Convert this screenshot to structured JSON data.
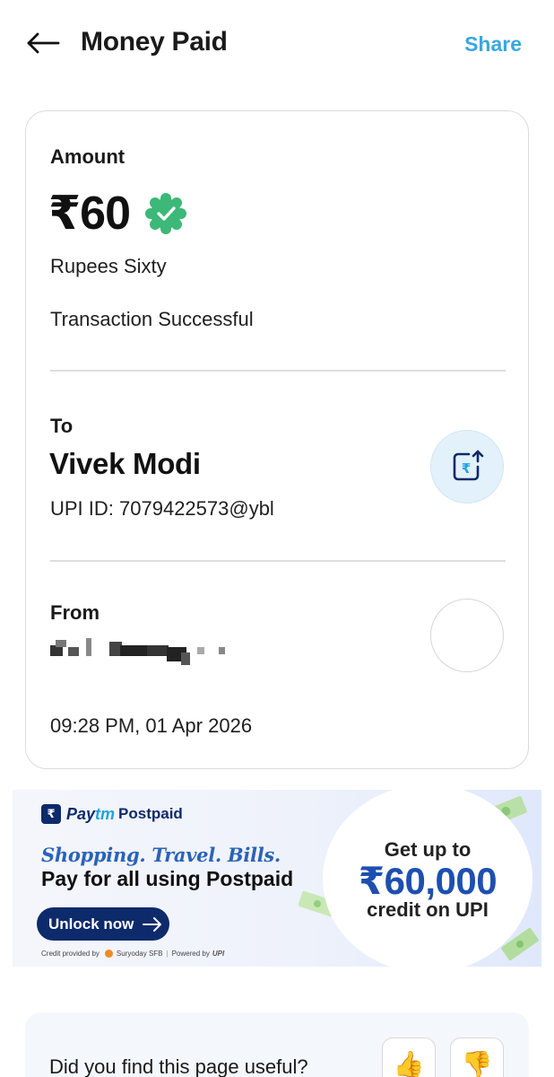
{
  "header": {
    "title": "Money Paid",
    "share_label": "Share",
    "back_icon": "arrow-left-icon"
  },
  "transaction": {
    "amount_label": "Amount",
    "amount": "₹60",
    "amount_in_words": "Rupees Sixty",
    "status": "Transaction Successful",
    "status_icon": "verified-check-badge-icon",
    "status_color": "#3cb878"
  },
  "recipient": {
    "label": "To",
    "name": "Vivek Modi",
    "upi_id": "UPI ID: 7079422573@ybl",
    "action_icon": "rupee-send-icon"
  },
  "sender": {
    "label": "From",
    "name_redacted": true
  },
  "timestamp": "09:28 PM, 01 Apr 2026",
  "promo_banner": {
    "brand": "Paytm",
    "brand_paytm_pay": "Pay",
    "brand_paytm_tm": "tm",
    "brand_product": "Postpaid",
    "tagline": "Shopping. Travel. Bills.",
    "headline": "Pay for all using Postpaid",
    "cta_label": "Unlock now",
    "footer_credit": "Credit provided by",
    "footer_lender": "Suryoday SFB",
    "footer_powered": "Powered by",
    "footer_upi": "UPI",
    "offer_top": "Get up to",
    "offer_amount": "₹60,000",
    "offer_bottom": "credit on UPI",
    "brand_color": "#0d2a6b",
    "accent_color": "#1fa4e0"
  },
  "feedback": {
    "question": "Did you find this page useful?",
    "thumbs_up_icon": "thumbs-up-icon",
    "thumbs_down_icon": "thumbs-down-icon"
  },
  "colors": {
    "share": "#3aa7e0",
    "card_border": "#dcdcdc"
  }
}
